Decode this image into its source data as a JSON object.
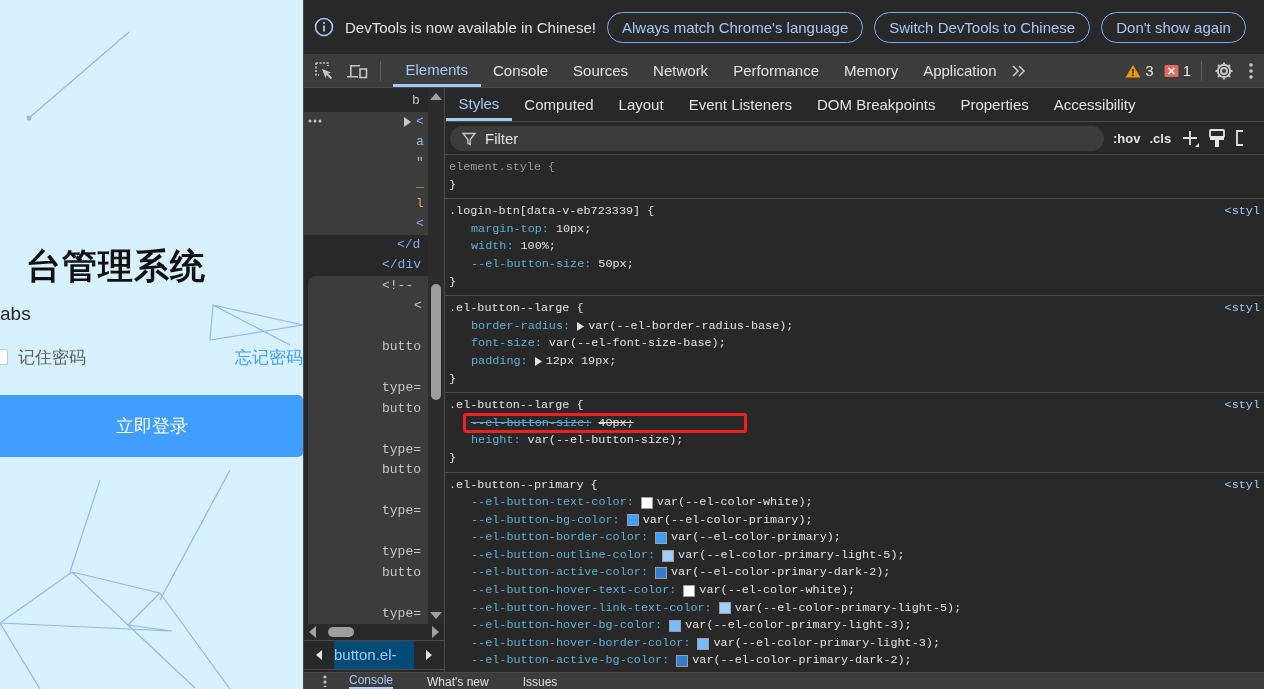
{
  "page": {
    "title": "台管理系统",
    "subtitle": "abs",
    "remember": {
      "label": "记住密码",
      "checked": false
    },
    "forgot_link": "忘记密码",
    "login_button": "立即登录"
  },
  "devtools": {
    "infobar": {
      "message": "DevTools is now available in Chinese!",
      "buttons": [
        "Always match Chrome's language",
        "Switch DevTools to Chinese",
        "Don't show again"
      ]
    },
    "main_tabs": [
      {
        "label": "Elements",
        "selected": true
      },
      {
        "label": "Console",
        "selected": false
      },
      {
        "label": "Sources",
        "selected": false
      },
      {
        "label": "Network",
        "selected": false
      },
      {
        "label": "Performance",
        "selected": false
      },
      {
        "label": "Memory",
        "selected": false
      },
      {
        "label": "Application",
        "selected": false
      }
    ],
    "warnings": "3",
    "errors": "1",
    "element_groups": [
      {
        "selected": false,
        "hovered": false,
        "lines": [
          {
            "text": "b",
            "kind": "text"
          }
        ]
      },
      {
        "selected": true,
        "hovered": false,
        "lines": [
          {
            "text": "<",
            "kind": "tag"
          },
          {
            "text": "a",
            "kind": "attr"
          },
          {
            "text": "\"",
            "kind": "quote"
          },
          {
            "text": "_",
            "kind": "value"
          },
          {
            "text": "l",
            "kind": "value"
          },
          {
            "text": "<",
            "kind": "tag"
          }
        ]
      },
      {
        "selected": false,
        "hovered": false,
        "lines": [
          {
            "text": "</d",
            "kind": "tag"
          },
          {
            "text": "</div",
            "kind": "tag"
          }
        ]
      },
      {
        "selected": false,
        "hovered": true,
        "lines": [
          {
            "text": "<!--",
            "kind": "comment"
          },
          {
            "text": "<",
            "kind": "comment"
          },
          {
            "text": "butto",
            "kind": "comment"
          },
          {
            "text": "type=",
            "kind": "comment"
          },
          {
            "text": "butto",
            "kind": "comment"
          },
          {
            "text": "type=",
            "kind": "comment"
          },
          {
            "text": "butto",
            "kind": "comment"
          },
          {
            "text": "type=",
            "kind": "comment"
          },
          {
            "text": "type=",
            "kind": "comment"
          },
          {
            "text": "butto",
            "kind": "comment"
          },
          {
            "text": "type=",
            "kind": "comment"
          }
        ]
      }
    ],
    "breadcrumb": "button.el-",
    "style_tabs": [
      {
        "label": "Styles",
        "selected": true
      },
      {
        "label": "Computed",
        "selected": false
      },
      {
        "label": "Layout",
        "selected": false
      },
      {
        "label": "Event Listeners",
        "selected": false
      },
      {
        "label": "DOM Breakpoints",
        "selected": false
      },
      {
        "label": "Properties",
        "selected": false
      },
      {
        "label": "Accessibility",
        "selected": false
      }
    ],
    "filter": {
      "placeholder": "Filter"
    },
    "filter_buttons": [
      ":hov",
      ".cls"
    ],
    "rules": [
      {
        "kind": "inline",
        "selector": "element.style {",
        "close": "}",
        "marked": false
      },
      {
        "kind": "rule",
        "selector": ".login-btn[data-v-eb723339] {",
        "source": "<styl",
        "close": "}",
        "marked": false,
        "declarations": [
          {
            "property": "margin-top:",
            "value": "10px;",
            "struck": false,
            "expandable": false
          },
          {
            "property": "width:",
            "value": "100%;",
            "struck": false,
            "expandable": false
          },
          {
            "property": "--el-button-size:",
            "value": "50px;",
            "struck": false,
            "expandable": false
          }
        ]
      },
      {
        "kind": "rule",
        "selector": ".el-button--large {",
        "source": "<styl",
        "close": "}",
        "marked": false,
        "declarations": [
          {
            "property": "border-radius:",
            "value": "var(--el-border-radius-base);",
            "struck": false,
            "expandable": true
          },
          {
            "property": "font-size:",
            "value": "var(--el-font-size-base);",
            "struck": false,
            "expandable": false
          },
          {
            "property": "padding:",
            "value": "12px 19px;",
            "struck": false,
            "expandable": true
          }
        ]
      },
      {
        "kind": "rule",
        "selector": ".el-button--large {",
        "source": "<styl",
        "close": "}",
        "marked": true,
        "declarations": [
          {
            "property": "--el-button-size:",
            "value": "40px;",
            "struck": true,
            "expandable": false
          },
          {
            "property": "height:",
            "value": "var(--el-button-size);",
            "struck": false,
            "expandable": false
          }
        ]
      },
      {
        "kind": "rule",
        "selector": ".el-button--primary {",
        "source": "<styl",
        "marked": false,
        "declarations": [
          {
            "property": "--el-button-text-color:",
            "value": "var(--el-color-white);",
            "struck": false,
            "expandable": false,
            "color": "#ffffff"
          },
          {
            "property": "--el-button-bg-color:",
            "value": "var(--el-color-primary);",
            "struck": false,
            "expandable": false,
            "color": "#409eff"
          },
          {
            "property": "--el-button-border-color:",
            "value": "var(--el-color-primary);",
            "struck": false,
            "expandable": false,
            "color": "#409eff"
          },
          {
            "property": "--el-button-outline-color:",
            "value": "var(--el-color-primary-light-5);",
            "struck": false,
            "expandable": false,
            "color": "#a0cfff"
          },
          {
            "property": "--el-button-active-color:",
            "value": "var(--el-color-primary-dark-2);",
            "struck": false,
            "expandable": false,
            "color": "#337ecc"
          },
          {
            "property": "--el-button-hover-text-color:",
            "value": "var(--el-color-white);",
            "struck": false,
            "expandable": false,
            "color": "#ffffff"
          },
          {
            "property": "--el-button-hover-link-text-color:",
            "value": "var(--el-color-primary-light-5);",
            "struck": false,
            "expandable": false,
            "color": "#a0cfff"
          },
          {
            "property": "--el-button-hover-bg-color:",
            "value": "var(--el-color-primary-light-3);",
            "struck": false,
            "expandable": false,
            "color": "#79bbff"
          },
          {
            "property": "--el-button-hover-border-color:",
            "value": "var(--el-color-primary-light-3);",
            "struck": false,
            "expandable": false,
            "color": "#79bbff"
          },
          {
            "property": "--el-button-active-bg-color:",
            "value": "var(--el-color-primary-dark-2);",
            "struck": false,
            "expandable": false,
            "color": "#337ecc"
          }
        ]
      }
    ],
    "drawer_tabs": [
      {
        "label": "Console",
        "selected": true
      },
      {
        "label": "What's new",
        "selected": false
      },
      {
        "label": "Issues",
        "selected": false
      }
    ]
  }
}
